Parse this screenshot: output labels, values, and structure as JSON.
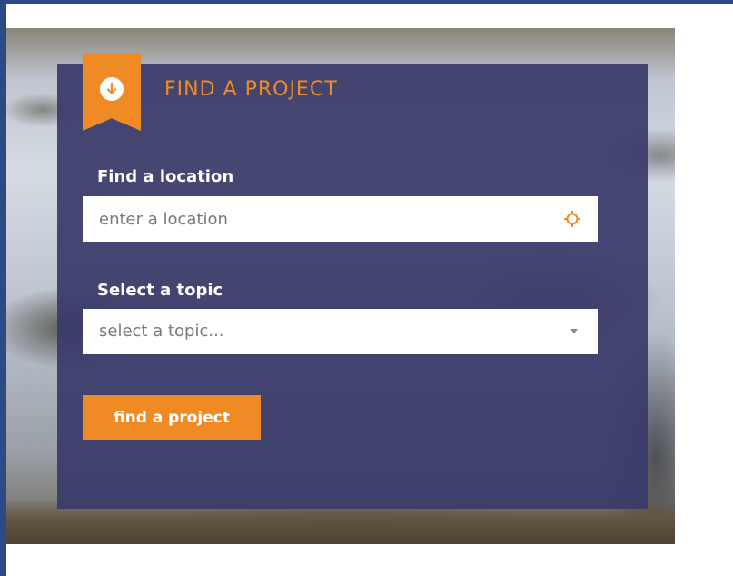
{
  "finder": {
    "title": "FIND A PROJECT",
    "ribbon_icon": "arrow-down-circle-icon",
    "location": {
      "label": "Find a location",
      "placeholder": "enter a location",
      "value": "",
      "action_icon": "crosshair-icon"
    },
    "topic": {
      "label": "Select a topic",
      "selected": "select a topic...",
      "dropdown_icon": "caret-down-icon"
    },
    "submit_label": "find a project"
  },
  "colors": {
    "accent": "#f08a24",
    "panel": "#3a3a69",
    "page_frame": "#2e4a86"
  }
}
